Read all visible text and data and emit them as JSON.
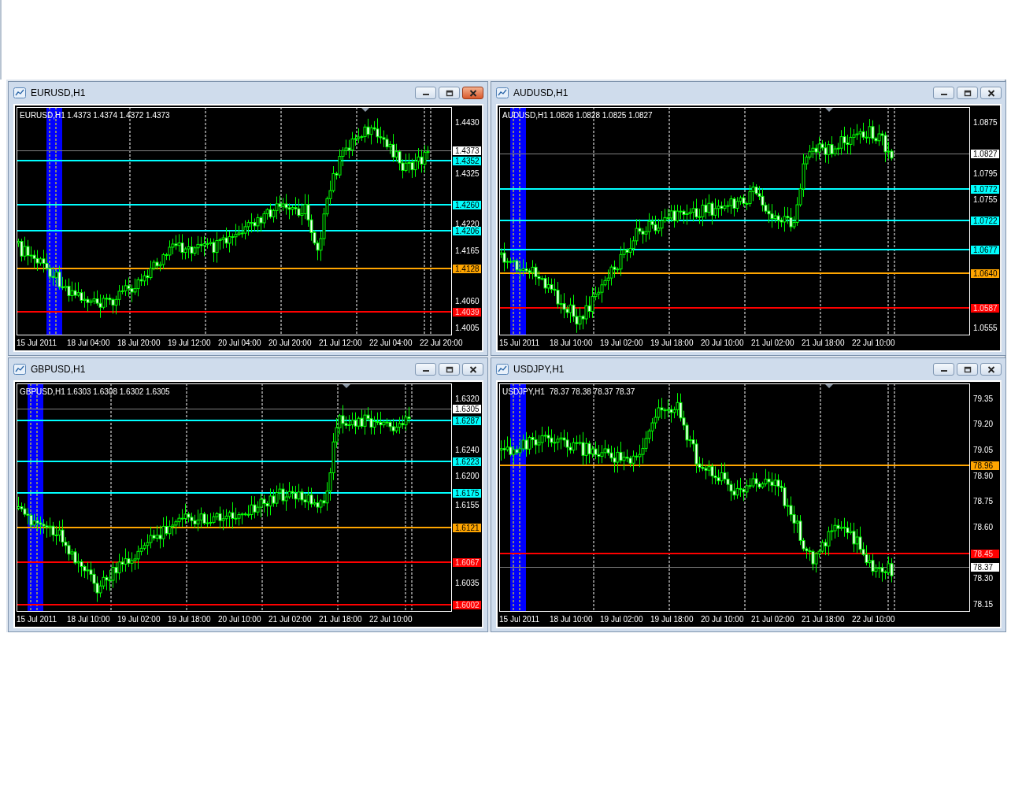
{
  "windows": [
    {
      "title": "EURUSD,H1",
      "active": true,
      "symbol_label": "EURUSD,H1",
      "ohlc": "1.4373 1.4374 1.4372 1.4373",
      "price_labels": [
        "1.4430",
        "1.4325",
        "1.4220",
        "1.4165",
        "1.4060",
        "1.4005"
      ],
      "levels": [
        {
          "kind": "bid",
          "price": "1.4373",
          "color": "#808080"
        },
        {
          "kind": "level",
          "price": "1.4352",
          "color": "#00ffff"
        },
        {
          "kind": "level",
          "price": "1.4260",
          "color": "#00ffff"
        },
        {
          "kind": "level",
          "price": "1.4206",
          "color": "#00ffff"
        },
        {
          "kind": "level",
          "price": "1.4128",
          "color": "#ffa500"
        },
        {
          "kind": "level",
          "price": "1.4039",
          "color": "#ff0000"
        }
      ],
      "time_labels": [
        "15 Jul 2011",
        "18 Jul 04:00",
        "18 Jul 20:00",
        "19 Jul 12:00",
        "20 Jul 04:00",
        "20 Jul 20:00",
        "21 Jul 12:00",
        "22 Jul 04:00",
        "22 Jul 20:00"
      ]
    },
    {
      "title": "AUDUSD,H1",
      "active": false,
      "symbol_label": "AUDUSD,H1",
      "ohlc": "1.0826 1.0828 1.0825 1.0827",
      "price_labels": [
        "1.0875",
        "1.0795",
        "1.0755",
        "1.0555"
      ],
      "levels": [
        {
          "kind": "bid",
          "price": "1.0827",
          "color": "#808080"
        },
        {
          "kind": "level",
          "price": "1.0772",
          "color": "#00ffff"
        },
        {
          "kind": "level",
          "price": "1.0722",
          "color": "#00ffff"
        },
        {
          "kind": "level",
          "price": "1.0677",
          "color": "#00ffff"
        },
        {
          "kind": "level",
          "price": "1.0640",
          "color": "#ffa500"
        },
        {
          "kind": "level",
          "price": "1.0587",
          "color": "#ff0000"
        }
      ],
      "time_labels": [
        "15 Jul 2011",
        "18 Jul 10:00",
        "19 Jul 02:00",
        "19 Jul 18:00",
        "20 Jul 10:00",
        "21 Jul 02:00",
        "21 Jul 18:00",
        "22 Jul 10:00"
      ]
    },
    {
      "title": "GBPUSD,H1",
      "active": false,
      "symbol_label": "GBPUSD,H1",
      "ohlc": "1.6303 1.6308 1.6302 1.6305",
      "price_labels": [
        "1.6320",
        "1.6240",
        "1.6200",
        "1.6155",
        "1.6035"
      ],
      "levels": [
        {
          "kind": "bid",
          "price": "1.6305",
          "color": "#808080"
        },
        {
          "kind": "level",
          "price": "1.6287",
          "color": "#00ffff"
        },
        {
          "kind": "level",
          "price": "1.6223",
          "color": "#00ffff"
        },
        {
          "kind": "level",
          "price": "1.6175",
          "color": "#00ffff"
        },
        {
          "kind": "level",
          "price": "1.6121",
          "color": "#ffa500"
        },
        {
          "kind": "level",
          "price": "1.6067",
          "color": "#ff0000"
        },
        {
          "kind": "level",
          "price": "1.6002",
          "color": "#ff0000"
        }
      ],
      "time_labels": [
        "15 Jul 2011",
        "18 Jul 10:00",
        "19 Jul 02:00",
        "19 Jul 18:00",
        "20 Jul 10:00",
        "21 Jul 02:00",
        "21 Jul 18:00",
        "22 Jul 10:00"
      ]
    },
    {
      "title": "USDJPY,H1",
      "active": false,
      "symbol_label": "USDJPY,H1",
      "ohlc": "78.37 78.38 78.37 78.37",
      "price_labels": [
        "79.35",
        "79.20",
        "79.05",
        "78.90",
        "78.75",
        "78.60",
        "78.30",
        "78.15"
      ],
      "levels": [
        {
          "kind": "level",
          "price": "78.96",
          "color": "#ffa500"
        },
        {
          "kind": "level",
          "price": "78.45",
          "color": "#ff0000"
        },
        {
          "kind": "bid",
          "price": "78.37",
          "color": "#808080"
        }
      ],
      "time_labels": [
        "15 Jul 2011",
        "18 Jul 10:00",
        "19 Jul 02:00",
        "19 Jul 18:00",
        "20 Jul 10:00",
        "21 Jul 02:00",
        "21 Jul 18:00",
        "22 Jul 10:00"
      ]
    }
  ]
}
